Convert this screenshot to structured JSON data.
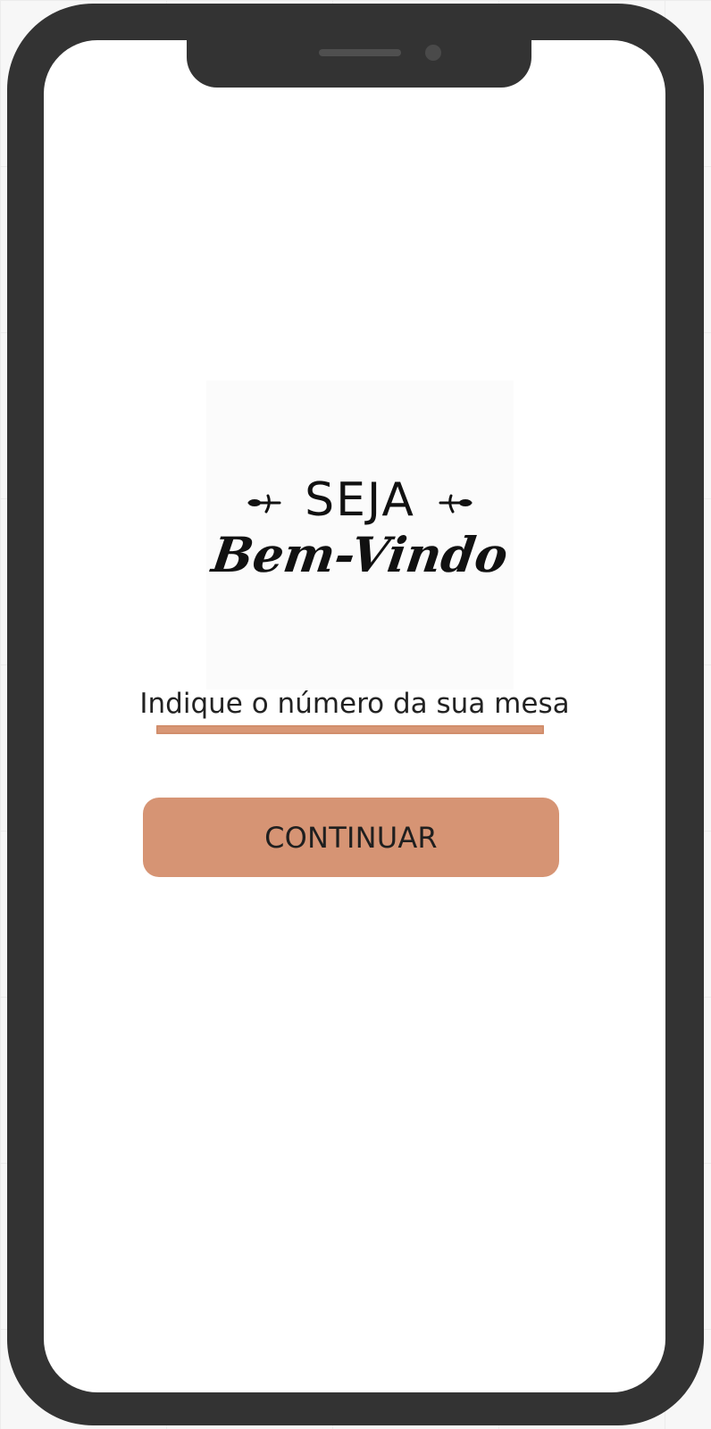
{
  "welcome": {
    "logo_line_1": "SEJA",
    "logo_line_2": "Bem-Vindo"
  },
  "table_prompt": "Indique o número da sua mesa",
  "table_input": {
    "value": "",
    "placeholder": ""
  },
  "continue_label": "CONTINUAR",
  "colors": {
    "accent": "#d69474",
    "phone_frame": "#333333",
    "screen_background": "#ffffff",
    "text": "#222222"
  }
}
